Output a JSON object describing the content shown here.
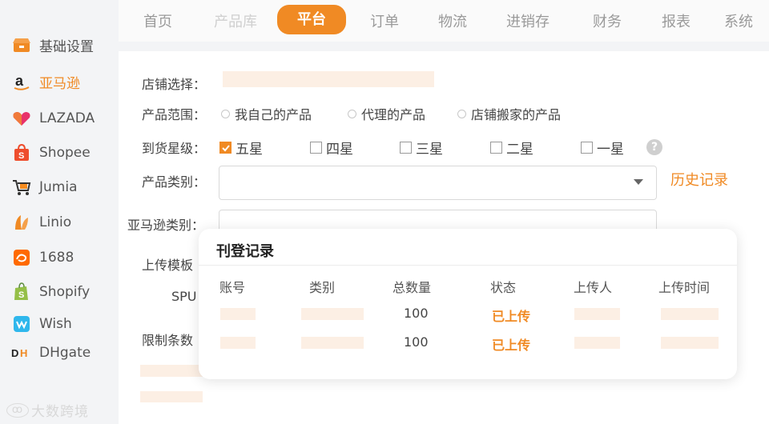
{
  "sidebar": {
    "items": [
      {
        "label": "基础设置",
        "icon": "store-icon"
      },
      {
        "label": "亚马逊",
        "icon": "amazon-logo-icon",
        "active": true
      },
      {
        "label": "LAZADA",
        "icon": "lazada-heart-icon"
      },
      {
        "label": "Shopee",
        "icon": "shopee-bag-icon"
      },
      {
        "label": "Jumia",
        "icon": "jumia-cart-icon"
      },
      {
        "label": "Linio",
        "icon": "linio-icon"
      },
      {
        "label": "1688",
        "icon": "alibaba-1688-icon"
      },
      {
        "label": "Shopify",
        "icon": "shopify-bag-icon"
      },
      {
        "label": "Wish",
        "icon": "wish-icon"
      },
      {
        "label": "DHgate",
        "icon": "dhgate-icon"
      }
    ],
    "watermark": "大数跨境"
  },
  "nav": {
    "items": [
      {
        "label": "首页"
      },
      {
        "label": "产品库",
        "dim": true
      },
      {
        "label": "平台",
        "active": true
      },
      {
        "label": "订单"
      },
      {
        "label": "物流"
      },
      {
        "label": "进销存"
      },
      {
        "label": "财务"
      },
      {
        "label": "报表"
      },
      {
        "label": "系统"
      }
    ]
  },
  "form": {
    "store_label": "店铺选择：",
    "range_label": "产品范围：",
    "range_options": [
      "我自己的产品",
      "代理的产品",
      "店铺搬家的产品"
    ],
    "star_label": "到货星级：",
    "star_options": [
      {
        "label": "五星",
        "checked": true
      },
      {
        "label": "四星",
        "checked": false
      },
      {
        "label": "三星",
        "checked": false
      },
      {
        "label": "二星",
        "checked": false
      },
      {
        "label": "一星",
        "checked": false
      }
    ],
    "category_label": "产品类别：",
    "history_link": "历史记录",
    "amazon_category_label": "亚马逊类别：",
    "template_label": "上传模板",
    "spu_label": "SPU",
    "limit_label": "限制条数"
  },
  "popup": {
    "title": "刊登记录",
    "headers": [
      "账号",
      "类别",
      "总数量",
      "状态",
      "上传人",
      "上传时间"
    ],
    "rows": [
      {
        "total": "100",
        "status": "已上传"
      },
      {
        "total": "100",
        "status": "已上传"
      }
    ]
  },
  "colors": {
    "accent": "#f08a24",
    "placeholder": "#fcefe4"
  }
}
